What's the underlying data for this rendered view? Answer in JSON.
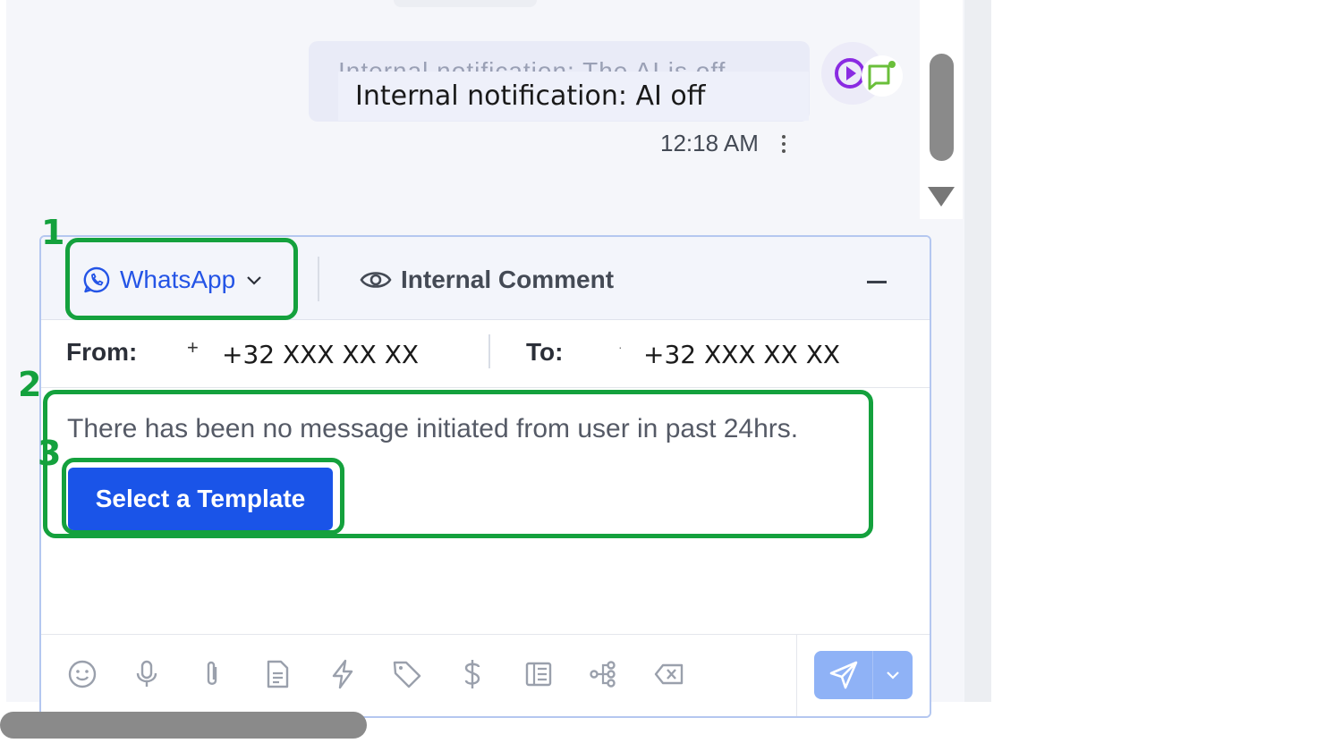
{
  "chat": {
    "previous_message_ghost": "Internal notification: The AI is off",
    "message_text": "Internal notification: AI off",
    "timestamp": "12:18 AM",
    "more_icon": "kebab-icon"
  },
  "composer": {
    "tabs": {
      "whatsapp_label": "WhatsApp",
      "internal_comment_label": "Internal Comment"
    },
    "from_label": "From:",
    "from_prefix": "+",
    "from_value": "+32 XXX XX XX",
    "to_label": "To:",
    "to_prefix": "·",
    "to_value": "+32 XXX XX XX",
    "notice": "There has been no message initiated from user in past 24hrs.",
    "template_button": "Select a Template",
    "toolbar_icons": [
      "emoji-icon",
      "microphone-icon",
      "paperclip-icon",
      "document-icon",
      "lightning-icon",
      "tag-icon",
      "dollar-icon",
      "article-icon",
      "workflow-icon",
      "clear-icon"
    ],
    "send_icon": "send-icon"
  },
  "annotations": {
    "label_1": "1",
    "label_2": "2",
    "label_3": "3",
    "color": "#14a13d"
  },
  "colors": {
    "accent": "#1a54e8",
    "whatsapp_tab": "#2454e6",
    "send_disabled": "#8fb2f6"
  }
}
